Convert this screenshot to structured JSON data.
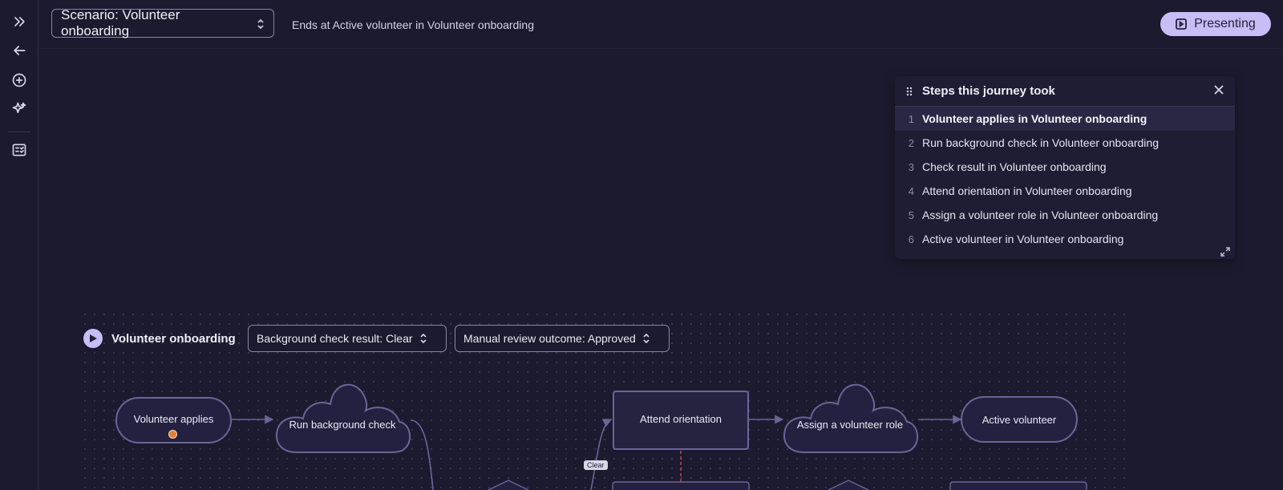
{
  "sidebar": {
    "items": [
      {
        "icon": "chevrons-right-icon"
      },
      {
        "icon": "arrow-left-icon"
      },
      {
        "icon": "plus-circle-icon"
      },
      {
        "icon": "sparkles-icon"
      },
      {
        "icon": "checklist-icon"
      }
    ]
  },
  "header": {
    "scenario_label": "Scenario: Volunteer onboarding",
    "ends_text": "Ends at Active volunteer in Volunteer onboarding",
    "present_label": "Presenting"
  },
  "steps_panel": {
    "title": "Steps this journey took",
    "active_index": 1,
    "steps": [
      {
        "num": "1",
        "label": "Volunteer applies in Volunteer onboarding"
      },
      {
        "num": "2",
        "label": "Run background check in Volunteer onboarding"
      },
      {
        "num": "3",
        "label": "Check result in Volunteer onboarding"
      },
      {
        "num": "4",
        "label": "Attend orientation in Volunteer onboarding"
      },
      {
        "num": "5",
        "label": "Assign a volunteer role in Volunteer onboarding"
      },
      {
        "num": "6",
        "label": "Active volunteer in Volunteer onboarding"
      }
    ]
  },
  "flow": {
    "title": "Volunteer onboarding",
    "selects": [
      {
        "label": "Background check result: Clear"
      },
      {
        "label": "Manual review outcome: Approved"
      }
    ],
    "nodes": {
      "volunteer_applies": "Volunteer applies",
      "run_background_check": "Run background check",
      "attend_orientation": "Attend orientation",
      "assign_role": "Assign a volunteer role",
      "active_volunteer": "Active volunteer"
    },
    "edge_label_clear": "Clear"
  },
  "colors": {
    "background": "#1c1a2e",
    "accent": "#c9bdf6",
    "node_border": "#6a6597",
    "start_dot": "#e07f36",
    "highlight_edge": "#d94a5a"
  }
}
